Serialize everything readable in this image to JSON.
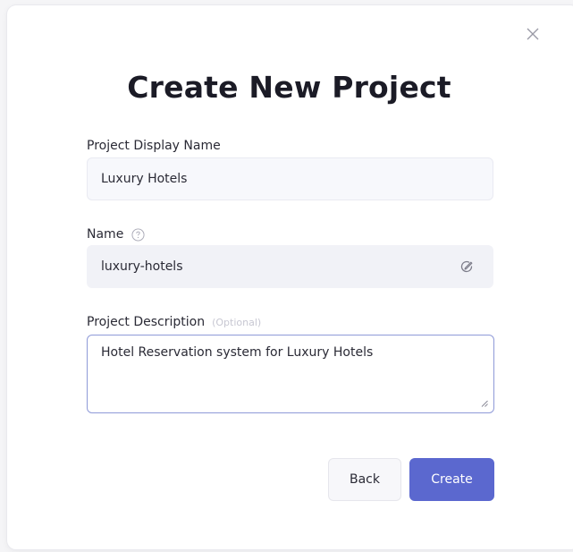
{
  "dialog": {
    "title": "Create New Project",
    "close_icon": "close-icon"
  },
  "form": {
    "display_name": {
      "label": "Project Display Name",
      "value": "Luxury Hotels"
    },
    "name": {
      "label": "Name",
      "help_icon": "question-circle-icon",
      "value": "luxury-hotels",
      "edit_icon": "edit-icon"
    },
    "description": {
      "label": "Project Description",
      "optional_text": "(Optional)",
      "value": "Hotel Reservation system for Luxury Hotels"
    }
  },
  "actions": {
    "back_label": "Back",
    "create_label": "Create"
  },
  "colors": {
    "primary": "#5b68cf",
    "focus_border": "#8f9ad8",
    "title_text": "#1b1b26"
  }
}
